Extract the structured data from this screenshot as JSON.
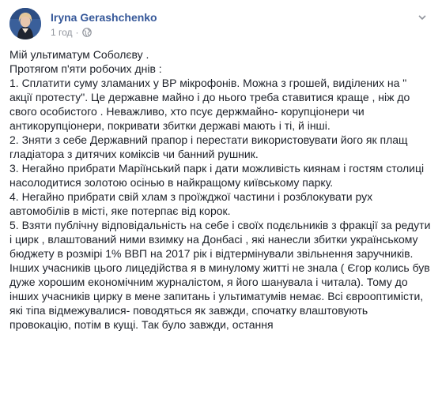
{
  "post": {
    "author": "Iryna Gerashchenko",
    "time": "1 год",
    "meta_separator": "·",
    "paragraphs": [
      "Мій ультиматум Соболєву .\nПротягом п'яти робочих днів :",
      "1. Сплатити суму зламаних у ВР мікрофонів. Можна з грошей, виділених на \" акції протесту\". Це державне майно і до нього треба ставитися краще , ніж до свого особистого . Неважливо, хто псує держмайно- корупціонери чи антикорупціонери, покривати збитки державі мають і ті, й інші.",
      "2. Зняти з себе Державний прапор і перестати використовувати його як плащ гладіатора з дитячих коміксів чи банний рушник.",
      "3. Негайно прибрати Маріїнський парк і дати можливість киянам і гостям столиці насолодитися золотою осінью в найкращому київському парку.",
      "4. Негайно прибрати свій хлам з проїжджої частини і розблокувати рух автомобілів в місті, яке потерпає від корок.",
      "5. Взяти публічну відповідальність на себе і своїх подєльників з фракції за редути і цирк , влаштований ними взимку на Донбасі , які нанесли збитки українському бюджету в розмірі 1% ВВП на 2017 рік і відтермінували звільнення заручників.",
      "Інших учасників цього лицедійства я в минулому житті не знала ( Єгор колись був дуже хорошим економічним журналістом, я його шанувала і читала). Тому до інших учасників цирку в мене запитань і ультиматумів немає. Всі єврооптимісти, які тіпа відмежувалися- поводяться як завжди, спочатку влаштовують провокацію, потім в кущі. Так було завжди, остання"
    ]
  },
  "colors": {
    "author": "#365899",
    "meta": "#90949c",
    "text": "#1d2129"
  },
  "icons": {
    "globe": "globe-icon",
    "chevron": "chevron-down-icon"
  }
}
